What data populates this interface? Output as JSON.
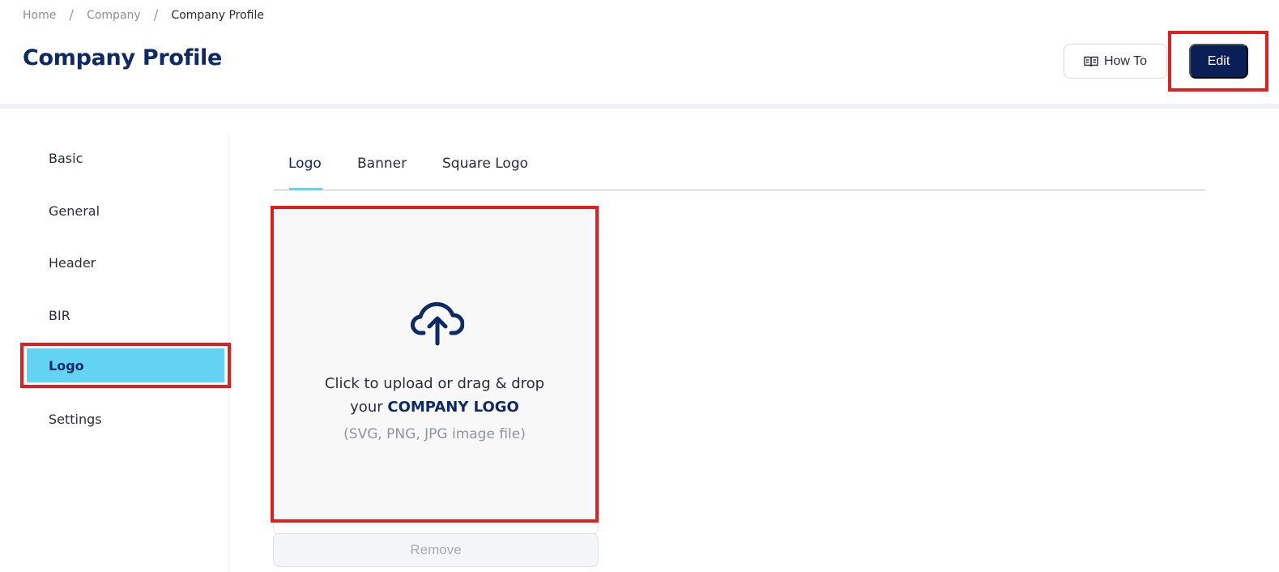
{
  "breadcrumb": {
    "items": [
      "Home",
      "Company",
      "Company Profile"
    ],
    "separator": "/"
  },
  "page": {
    "title": "Company Profile"
  },
  "header_actions": {
    "howto_label": "How To",
    "howto_icon": "book-open-icon",
    "edit_label": "Edit"
  },
  "sidebar": {
    "items": [
      {
        "label": "Basic"
      },
      {
        "label": "General"
      },
      {
        "label": "Header"
      },
      {
        "label": "BIR"
      },
      {
        "label": "Logo",
        "active": true
      },
      {
        "label": "Settings"
      }
    ]
  },
  "tabs": {
    "items": [
      {
        "label": "Logo",
        "active": true
      },
      {
        "label": "Banner"
      },
      {
        "label": "Square Logo"
      }
    ]
  },
  "upload": {
    "icon": "cloud-upload-icon",
    "line1": "Click to upload or drag & drop",
    "line2_prefix": "your ",
    "line2_strong": "COMPANY LOGO",
    "line3": "(SVG, PNG, JPG image file)",
    "remove_label": "Remove"
  },
  "colors": {
    "brand_navy": "#0d2a66",
    "edit_button": "#0b1f57",
    "active_highlight": "#62d4f2",
    "annotation_red": "#e02020"
  }
}
